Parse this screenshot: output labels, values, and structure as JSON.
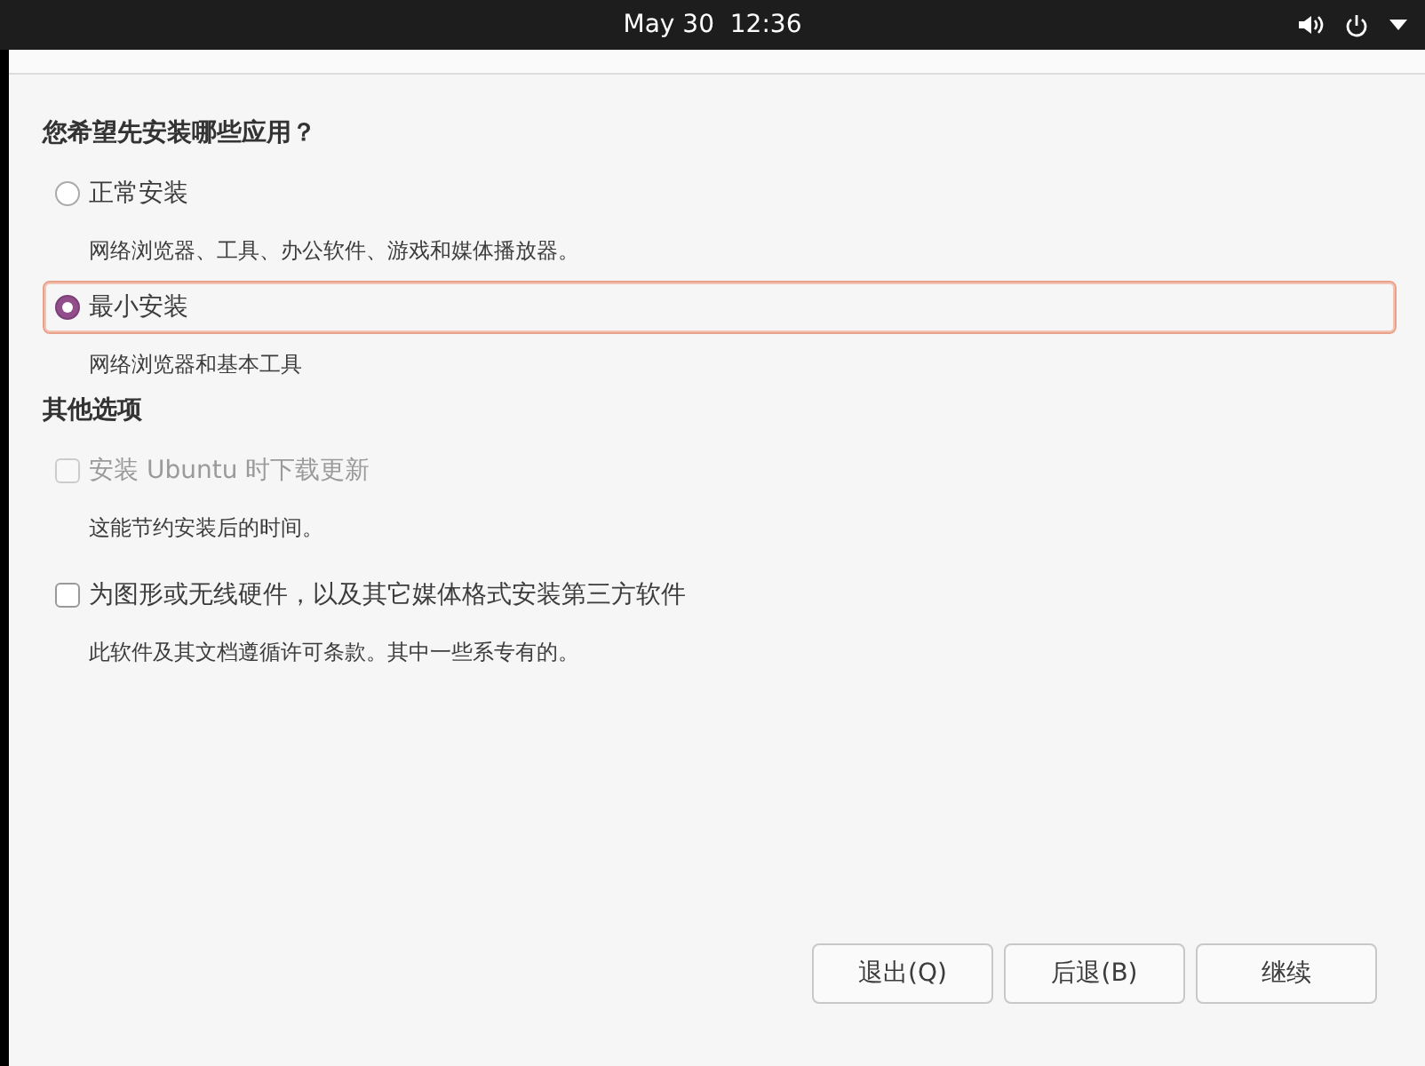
{
  "top_bar": {
    "clock": "May 30  12:36"
  },
  "install_type": {
    "heading": "您希望先安装哪些应用？",
    "options": [
      {
        "label": "正常安装",
        "description": "网络浏览器、工具、办公软件、游戏和媒体播放器。",
        "selected": false,
        "focused": false
      },
      {
        "label": "最小安装",
        "description": "网络浏览器和基本工具",
        "selected": true,
        "focused": true
      }
    ]
  },
  "other_options": {
    "heading": "其他选项",
    "items": [
      {
        "label": "安装 Ubuntu 时下载更新",
        "description": "这能节约安装后的时间。",
        "checked": false,
        "disabled": true
      },
      {
        "label": "为图形或无线硬件，以及其它媒体格式安装第三方软件",
        "description": "此软件及其文档遵循许可条款。其中一些系专有的。",
        "checked": false,
        "disabled": false
      }
    ]
  },
  "buttons": [
    {
      "label": "退出(Q)"
    },
    {
      "label": "后退(B)"
    },
    {
      "label": "继续"
    }
  ]
}
